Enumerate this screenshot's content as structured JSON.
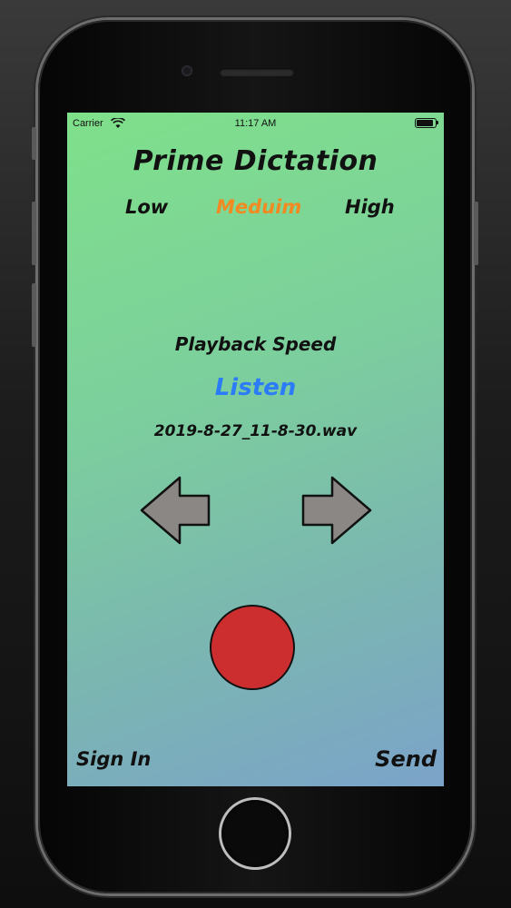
{
  "status_bar": {
    "carrier": "Carrier",
    "time": "11:17 AM"
  },
  "app": {
    "title": "Prime Dictation",
    "speed_options": [
      {
        "label": "Low",
        "selected": false
      },
      {
        "label": "Meduim",
        "selected": true
      },
      {
        "label": "High",
        "selected": false
      }
    ],
    "selected_color": "#f08a21",
    "playback_label": "Playback Speed",
    "listen_label": "Listen",
    "listen_color": "#2b7cf6",
    "filename": "2019-8-27_11-8-30.wav",
    "record_color": "#cc2e30",
    "sign_in_label": "Sign In",
    "send_label": "Send"
  },
  "icons": {
    "previous": "arrow-left-icon",
    "next": "arrow-right-icon",
    "record": "record-button"
  }
}
